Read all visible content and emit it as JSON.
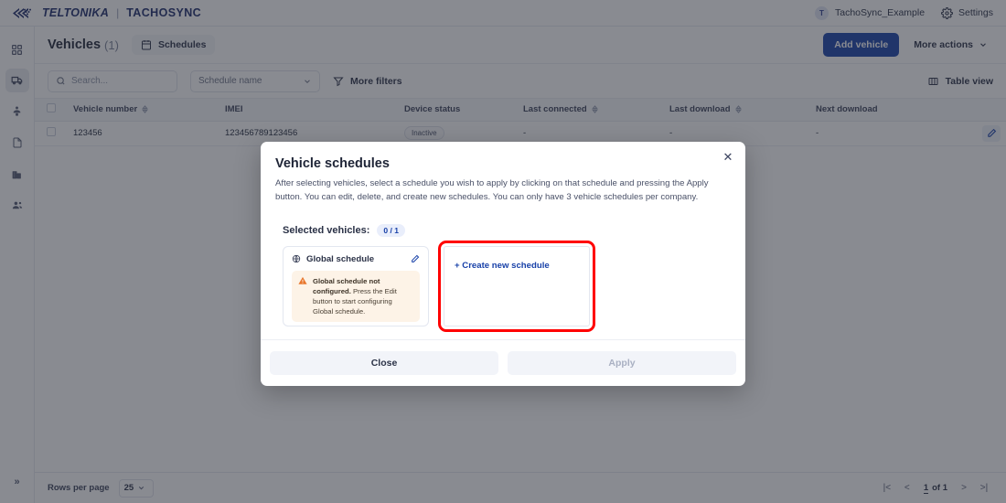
{
  "topbar": {
    "brand": "TELTONIKA",
    "brand_separator": "|",
    "brand_product": "TACHOSYNC",
    "user_initial": "T",
    "user_name": "TachoSync_Example",
    "settings_label": "Settings"
  },
  "sidebar": {
    "items": [
      {
        "name": "dashboard",
        "icon": "grid-icon",
        "active": false
      },
      {
        "name": "vehicles",
        "icon": "truck-icon",
        "active": true
      },
      {
        "name": "drivers",
        "icon": "driver-icon",
        "active": false
      },
      {
        "name": "files",
        "icon": "document-icon",
        "active": false
      },
      {
        "name": "companies",
        "icon": "building-icon",
        "active": false
      },
      {
        "name": "users",
        "icon": "users-icon",
        "active": false
      }
    ],
    "expand_label": "»"
  },
  "page": {
    "title": "Vehicles",
    "count": "(1)",
    "schedules_tab": "Schedules",
    "add_vehicle": "Add vehicle",
    "more_actions": "More actions"
  },
  "filters": {
    "search_placeholder": "Search...",
    "schedule_select": "Schedule name",
    "more_filters": "More filters",
    "table_view": "Table view"
  },
  "table": {
    "columns": [
      {
        "label": "Vehicle number",
        "sortable": true
      },
      {
        "label": "IMEI",
        "sortable": false
      },
      {
        "label": "Device status",
        "sortable": false
      },
      {
        "label": "Last connected",
        "sortable": true
      },
      {
        "label": "Last download",
        "sortable": true
      },
      {
        "label": "Next download",
        "sortable": false
      }
    ],
    "rows": [
      {
        "vehicle_number": "123456",
        "imei": "123456789123456",
        "device_status": "Inactive",
        "last_connected": "-",
        "last_download": "-",
        "next_download": "-"
      }
    ]
  },
  "pagination": {
    "rows_per_page_label": "Rows per page",
    "rows_per_page_value": "25",
    "page_number": "1",
    "page_of": "of 1",
    "first_label": "|<",
    "prev_label": "<",
    "next_label": ">",
    "last_label": ">|"
  },
  "modal": {
    "title": "Vehicle schedules",
    "description": "After selecting vehicles, select a schedule you wish to apply by clicking on that schedule and pressing the Apply button. You can edit, delete, and create new schedules. You can only have 3 vehicle schedules per company.",
    "close_label": "✕",
    "selected_vehicles_label": "Selected vehicles:",
    "selected_vehicles_count": "0 / 1",
    "schedule_card": {
      "title": "Global schedule",
      "warning_title": "Global schedule not configured.",
      "warning_body": "Press the Edit button to start configuring Global schedule."
    },
    "create_card": {
      "link": "+ Create new schedule",
      "highlight_color": "#ff0000"
    },
    "close_button": "Close",
    "apply_button": "Apply"
  },
  "colors": {
    "brand_blue": "#1740a8",
    "warning_orange": "#e8762c",
    "backdrop": "rgba(40,43,55,0.55)"
  }
}
